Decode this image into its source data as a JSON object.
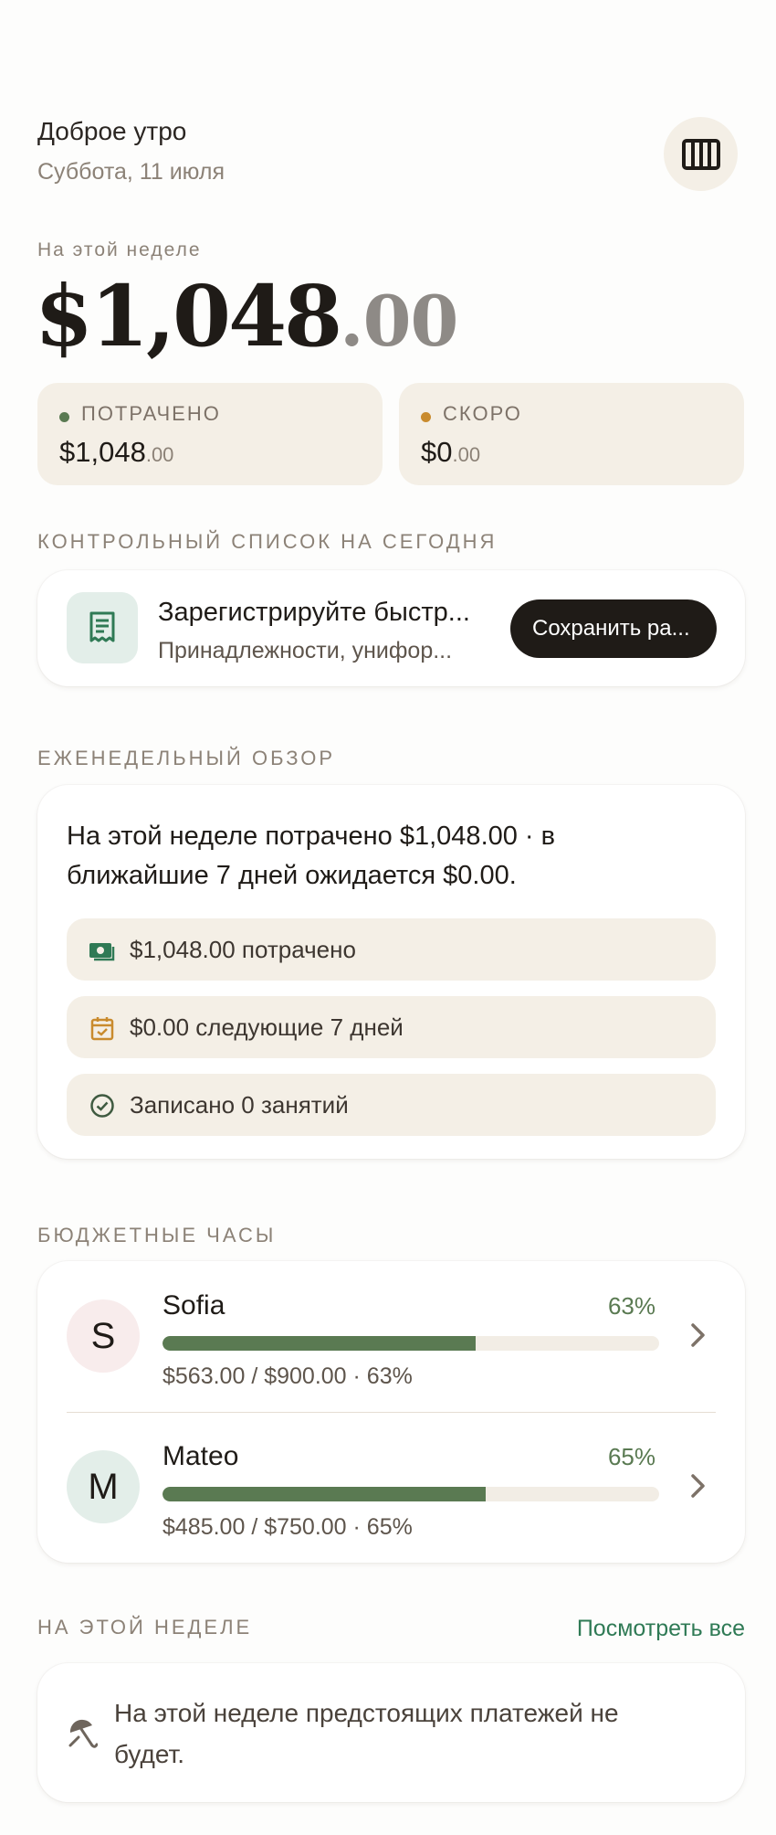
{
  "header": {
    "greeting": "Доброе утро",
    "date": "Суббота, 11 июля",
    "calendar_icon": "calendar-columns-icon"
  },
  "summary": {
    "label": "На этой неделе",
    "amount_main": "$1,048",
    "amount_cents": ".00",
    "spent": {
      "label": "ПОТРАЧЕНО",
      "main": "$1,048",
      "cents": ".00",
      "dot_color": "#5a7a52"
    },
    "upcoming": {
      "label": "СКОРО",
      "main": "$0",
      "cents": ".00",
      "dot_color": "#c98b2e"
    }
  },
  "checklist": {
    "title": "КОНТРОЛЬНЫЙ СПИСОК НА СЕГОДНЯ",
    "item": {
      "icon": "receipt-icon",
      "title": "Зарегистрируйте быстр...",
      "subtitle": "Принадлежности, унифор...",
      "button": "Сохранить ра..."
    }
  },
  "overview": {
    "title": "ЕЖЕНЕДЕЛЬНЫЙ ОБЗОР",
    "text": "На этой неделе потрачено $1,048.00 · в ближайшие 7 дней ожидается $0.00.",
    "pills": [
      {
        "icon": "cash-icon",
        "text": "$1,048.00 потрачено"
      },
      {
        "icon": "calendar-check-icon",
        "text": "$0.00 следующие 7 дней"
      },
      {
        "icon": "check-circle-icon",
        "text": "Записано 0 занятий"
      }
    ]
  },
  "budget": {
    "title": "БЮДЖЕТНЫЕ ЧАСЫ",
    "people": [
      {
        "initial": "S",
        "name": "Sofia",
        "percent_label": "63%",
        "progress": 0.63,
        "detail": "$563.00 / $900.00 · 63%",
        "avatar_color": "#f8ecec"
      },
      {
        "initial": "M",
        "name": "Mateo",
        "percent_label": "65%",
        "progress": 0.65,
        "detail": "$485.00 / $750.00 · 65%",
        "avatar_color": "#e3eee9"
      }
    ]
  },
  "this_week": {
    "title": "НА ЭТОЙ НЕДЕЛЕ",
    "see_all": "Посмотреть все",
    "empty_icon": "umbrella-icon",
    "empty_text": "На этой неделе предстоящих платежей не будет."
  },
  "colors": {
    "accent_green": "#5a7a52",
    "link_green": "#2f7a55",
    "amber": "#c98b2e",
    "dark": "#1f1b17",
    "cream": "#f4efe6"
  }
}
